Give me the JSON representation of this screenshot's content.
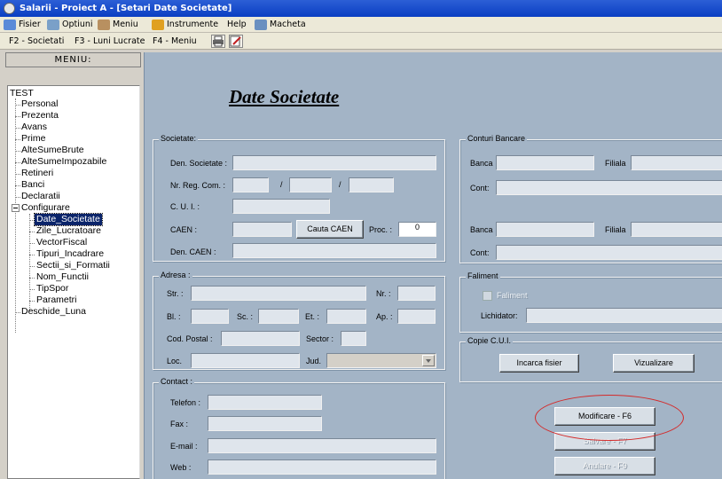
{
  "window": {
    "title": "Salarii - Proiect A - [Setari Date Societate]"
  },
  "menubar": [
    {
      "label": "Fisier",
      "icon": "search-icon"
    },
    {
      "label": "Optiuni",
      "icon": "options-icon"
    },
    {
      "label": "Meniu",
      "icon": "pencil-icon"
    },
    {
      "label": "Instrumente",
      "icon": "tools-icon"
    },
    {
      "label": "Help",
      "icon": ""
    },
    {
      "label": "Macheta",
      "icon": "layout-icon"
    }
  ],
  "toolbar": {
    "f2": "F2 - Societati",
    "f3": "F3 - Luni Lucrate",
    "f4": "F4 - Meniu"
  },
  "sidebar": {
    "header": "MENIU:",
    "root": "TEST",
    "items": [
      "Personal",
      "Prezenta",
      "Avans",
      "Prime",
      "AlteSumeBrute",
      "AlteSumeImpozabile",
      "Retineri",
      "Banci",
      "Declaratii"
    ],
    "group": "Configurare",
    "subitems": [
      "Date_Societate",
      "Zile_Lucratoare",
      "VectorFiscal",
      "Tipuri_Incadrare",
      "Sectii_si_Formatii",
      "Nom_Functii",
      "TipSpor",
      "Parametri"
    ],
    "last": "Deschide_Luna",
    "selected": "Date_Societate"
  },
  "page": {
    "title": "Date Societate"
  },
  "societate": {
    "legend": "Societate:",
    "den_label": "Den. Societate :",
    "den": "",
    "reg_label": "Nr. Reg. Com. :",
    "reg1": "",
    "reg2": "",
    "reg3": "",
    "slash": "/",
    "cui_label": "C. U. I. :",
    "cui": "",
    "caen_label": "CAEN :",
    "caen": "",
    "cauta_caen": "Cauta CAEN",
    "proc_label": "Proc. :",
    "proc": "0",
    "den_caen_label": "Den. CAEN :",
    "den_caen": ""
  },
  "adresa": {
    "legend": "Adresa :",
    "str_label": "Str. :",
    "nr_label": "Nr. :",
    "bl_label": "Bl. :",
    "sc_label": "Sc. :",
    "et_label": "Et. :",
    "ap_label": "Ap. :",
    "cod_label": "Cod. Postal :",
    "sector_label": "Sector :",
    "loc_label": "Loc.",
    "jud_label": "Jud."
  },
  "contact": {
    "legend": "Contact :",
    "telefon_label": "Telefon :",
    "fax_label": "Fax :",
    "email_label": "E-mail :",
    "web_label": "Web :"
  },
  "conturi": {
    "legend": "Conturi Bancare",
    "banca_label": "Banca",
    "filiala_label": "Filiala",
    "cont_label": "Cont:"
  },
  "faliment": {
    "legend": "Faliment",
    "checkbox_label": "Faliment",
    "lichidator_label": "Lichidator:"
  },
  "copie": {
    "legend": "Copie C.U.I.",
    "incarca": "Incarca fisier",
    "vizualizare": "Vizualizare"
  },
  "actions": {
    "modificare": "Modificare  - F6",
    "salvare": "Salvare  - F7",
    "anulare": "Anulare  - F9"
  },
  "colors": {
    "titlebar": "#0a3ec2",
    "panel": "#a3b4c6",
    "highlight_ellipse": "#d42a2a",
    "selection": "#0a246a"
  }
}
